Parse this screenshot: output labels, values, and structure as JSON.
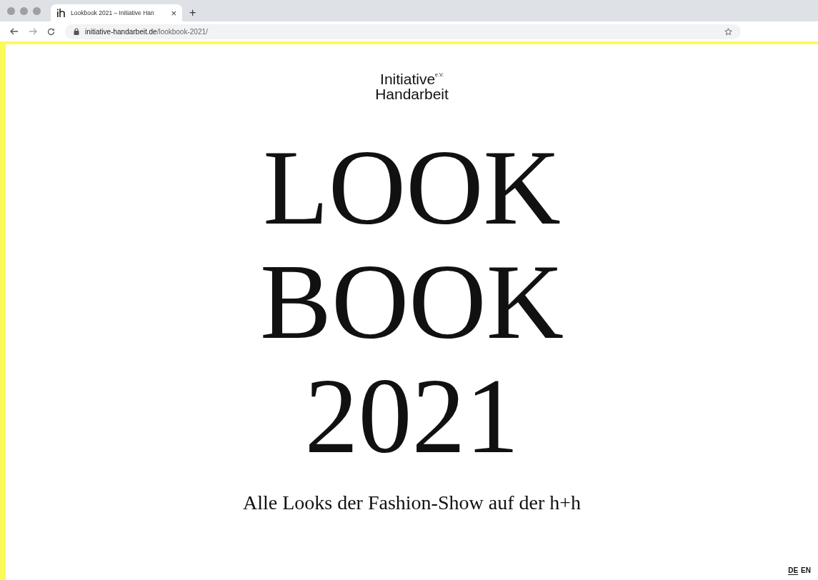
{
  "browser": {
    "tab": {
      "title": "Lookbook 2021 – Initiative Han",
      "close": "×",
      "selected": true
    },
    "new_tab": "+",
    "address": {
      "domain": "initiative-handarbeit.de",
      "path": "/lookbook-2021/"
    }
  },
  "logo": {
    "line_1": "Initiative",
    "suffix": "e.V.",
    "line_2": "Handarbeit"
  },
  "title_lines": [
    "LOOK",
    "BOOK",
    "2021"
  ],
  "subtitle": "Alle Looks der Fashion-Show auf der h+h",
  "languages": [
    {
      "label": "DE",
      "selected": true
    },
    {
      "label": "EN",
      "selected": false
    }
  ]
}
